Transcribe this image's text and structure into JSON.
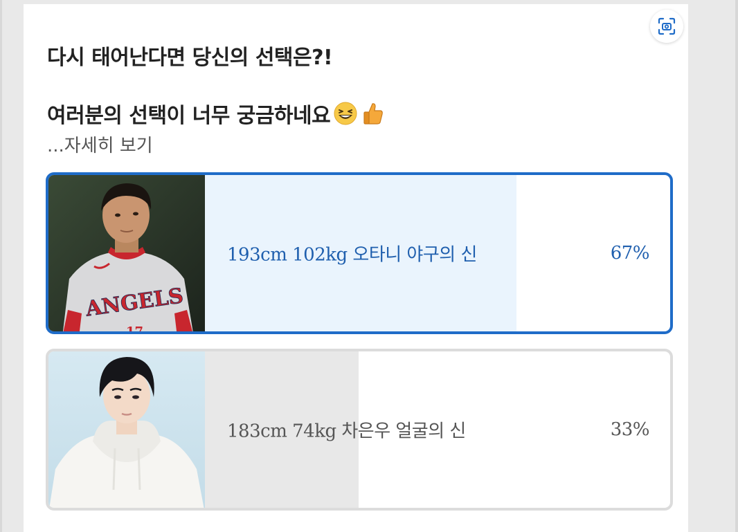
{
  "post": {
    "title": "다시 태어난다면 당신의 선택은?!",
    "subtitle": "여러분의 선택이 너무 궁금하네요",
    "subtitle_emojis": [
      "grinning-squinting-face",
      "thumbs-up"
    ],
    "more_link": "...자세히 보기"
  },
  "poll": {
    "options": [
      {
        "label": "193cm 102kg 오타니 야구의 신",
        "percent_text": "67%",
        "percent": 67,
        "selected": true,
        "image_desc": "baseball-player-photo",
        "jersey_text": "ANGELS"
      },
      {
        "label": "183cm 74kg 차은우 얼굴의 신",
        "percent_text": "33%",
        "percent": 33,
        "selected": false,
        "image_desc": "portrait-photo"
      }
    ]
  },
  "colors": {
    "selected_border": "#1f6cc8",
    "selected_fill": "#eaf4fd",
    "unselected_fill": "#e8e8e8",
    "selected_text": "#1f5fae"
  },
  "icons": {
    "scan": "image-scan-icon"
  }
}
